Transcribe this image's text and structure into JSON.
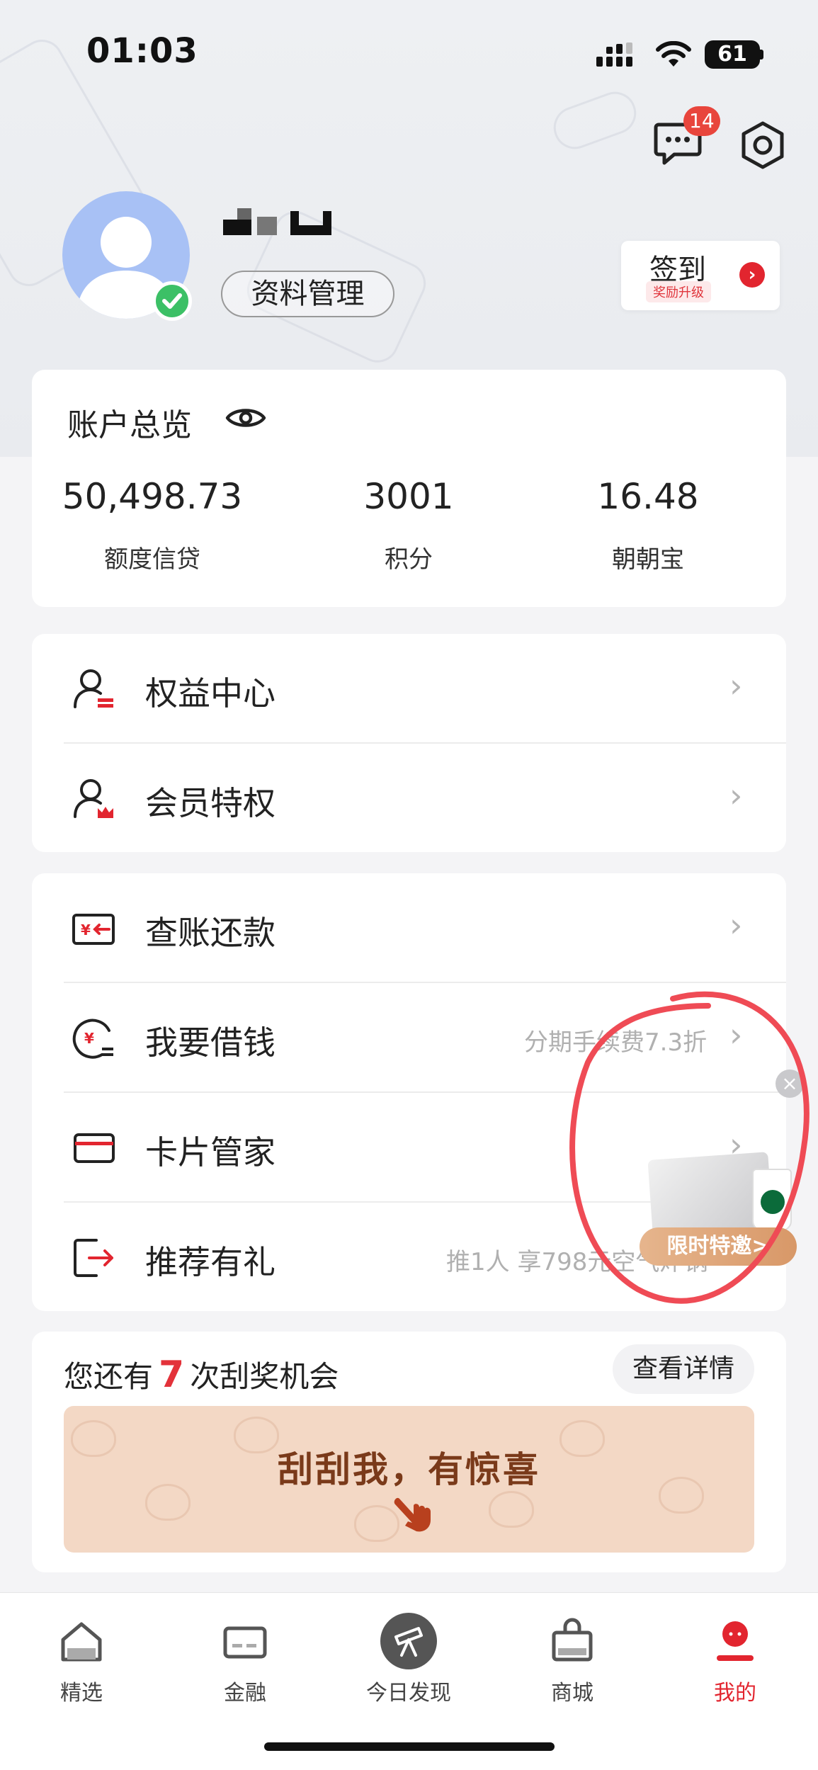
{
  "status_bar": {
    "time": "01:03",
    "battery": "61"
  },
  "header": {
    "message_badge": "14"
  },
  "profile": {
    "name_masked": "",
    "profile_button": "资料管理"
  },
  "signin": {
    "title": "签到",
    "subtitle": "奖励升级"
  },
  "overview": {
    "title": "账户总览",
    "stats": [
      {
        "value": "50,498.73",
        "label": "额度信贷"
      },
      {
        "value": "3001",
        "label": "积分"
      },
      {
        "value": "16.48",
        "label": "朝朝宝"
      }
    ]
  },
  "rights_menu": [
    {
      "label": "权益中心",
      "icon": "rights-center-icon"
    },
    {
      "label": "会员特权",
      "icon": "member-crown-icon"
    }
  ],
  "services_menu": [
    {
      "label": "查账还款",
      "hint": "",
      "icon": "bill-repay-icon"
    },
    {
      "label": "我要借钱",
      "hint": "分期手续费7.3折",
      "icon": "loan-icon"
    },
    {
      "label": "卡片管家",
      "hint": "",
      "icon": "card-icon"
    },
    {
      "label": "推荐有礼",
      "hint": "推1人 享798元空气炸锅",
      "icon": "referral-icon"
    }
  ],
  "scratch": {
    "prefix": "您还有",
    "count": "7",
    "suffix": "次刮奖机会",
    "detail_button": "查看详情",
    "cta": "刮刮我，有惊喜"
  },
  "promo": {
    "tag": "限时特邀>"
  },
  "tabs": [
    {
      "label": "精选",
      "icon": "home-icon"
    },
    {
      "label": "金融",
      "icon": "finance-card-icon"
    },
    {
      "label": "今日发现",
      "icon": "telescope-icon"
    },
    {
      "label": "商城",
      "icon": "shopping-bag-icon"
    },
    {
      "label": "我的",
      "icon": "profile-icon",
      "active": true
    }
  ],
  "colors": {
    "accent": "#e2252f",
    "annotation": "#ef4b55",
    "avatar": "#a8c1f5"
  }
}
